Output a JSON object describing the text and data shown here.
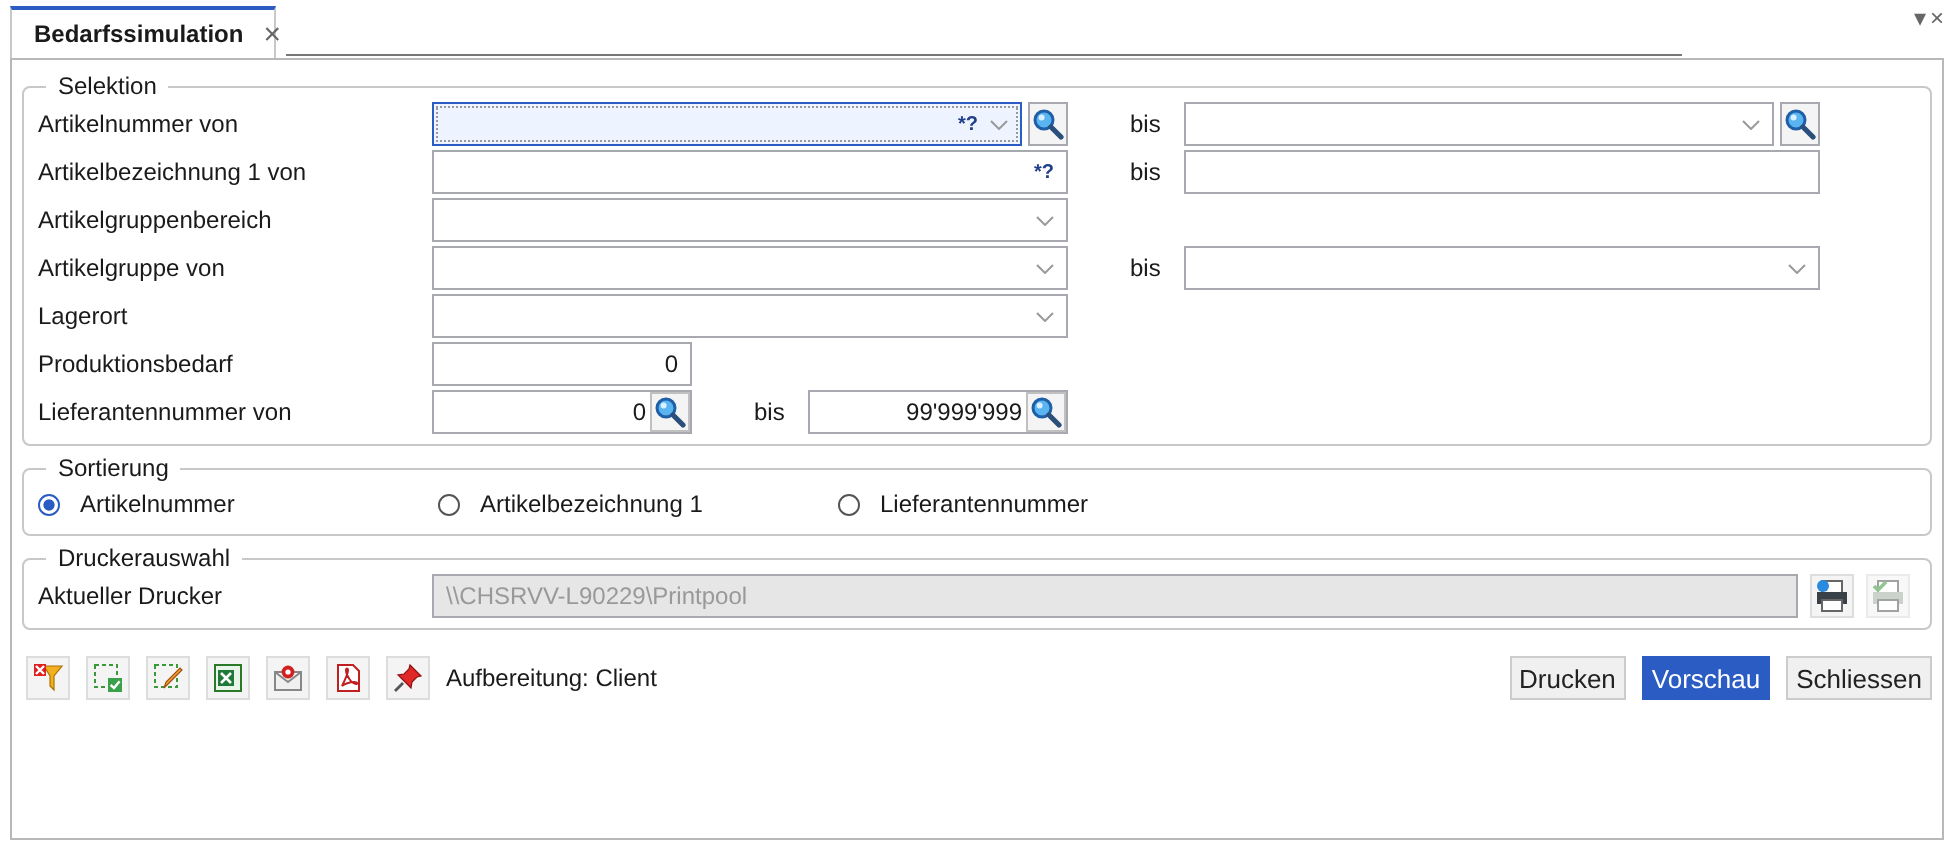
{
  "tab": {
    "label": "Bedarfssimulation",
    "selected": true,
    "close": "×"
  },
  "window_controls": [
    "▾",
    "×"
  ],
  "selektion": {
    "title": "Selektion",
    "rows": [
      {
        "label": "Artikelnummer von",
        "from": {
          "kind": "combo_search",
          "focused": true,
          "hint": "*?"
        },
        "to": {
          "label": "bis",
          "field": {
            "kind": "combo_search",
            "focused": false
          }
        }
      },
      {
        "label": "Artikelbezeichnung 1 von",
        "from": {
          "kind": "text",
          "focused": false,
          "hint": "*?"
        },
        "to": {
          "label": "bis",
          "field": {
            "kind": "text",
            "focused": false
          }
        }
      },
      {
        "label": "Artikelgruppenbereich",
        "from": {
          "kind": "combo",
          "focused": false
        }
      },
      {
        "label": "Artikelgruppe von",
        "from": {
          "kind": "combo",
          "focused": false
        },
        "to": {
          "label": "bis",
          "field": {
            "kind": "combo",
            "focused": false
          }
        }
      },
      {
        "label": "Lagerort",
        "from": {
          "kind": "combo",
          "focused": false
        }
      },
      {
        "label": "Produktionsbedarf",
        "from": {
          "kind": "number",
          "focused": false,
          "value": "0"
        }
      },
      {
        "label": "Lieferantennummer von",
        "from": {
          "kind": "number_search",
          "focused": false,
          "value": "0"
        },
        "to": {
          "label": "bis",
          "field": {
            "kind": "number_search",
            "focused": false,
            "value": "99'999'999"
          }
        }
      }
    ]
  },
  "sortierung": {
    "title": "Sortierung",
    "options": [
      {
        "label": "Artikelnummer",
        "selected": true
      },
      {
        "label": "Artikelbezeichnung 1",
        "selected": false
      },
      {
        "label": "Lieferantennummer",
        "selected": false
      }
    ]
  },
  "druckerauswahl": {
    "title": "Druckerauswahl",
    "label": "Aktueller Drucker",
    "value": "\\\\CHSRVV-L90229\\Printpool",
    "disabled": true,
    "buttons": [
      {
        "kind": "printer_settings",
        "disabled": false
      },
      {
        "kind": "printer_check",
        "disabled": true
      }
    ]
  },
  "toolbar": {
    "tools": [
      {
        "kind": "filter_clear"
      },
      {
        "kind": "select_check"
      },
      {
        "kind": "select_edit"
      },
      {
        "kind": "excel"
      },
      {
        "kind": "mail"
      },
      {
        "kind": "pdf"
      },
      {
        "kind": "pin"
      }
    ],
    "status": "Aufbereitung: Client"
  },
  "buttons": [
    {
      "label": "Drucken",
      "primary": false
    },
    {
      "label": "Vorschau",
      "primary": true
    },
    {
      "label": "Schliessen",
      "primary": false
    }
  ]
}
